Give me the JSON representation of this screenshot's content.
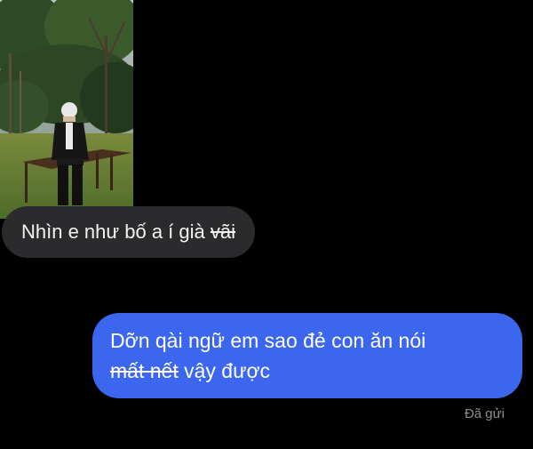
{
  "conversation": {
    "received": {
      "photo_description_icon": "photo-attachment",
      "text_normal": "Nhìn e như bố a í già ",
      "text_struck": "vãi"
    },
    "sent": {
      "line1": "Dỡn qài ngữ em sao đẻ con ăn nói",
      "line2_struck": "mất nết",
      "line2_normal": " vậy được"
    },
    "delivery_status": "Đã gửi"
  },
  "colors": {
    "background": "#000000",
    "received_bubble": "#2b2b2d",
    "sent_bubble": "#3c66ee",
    "status_text": "#8e8e93"
  }
}
